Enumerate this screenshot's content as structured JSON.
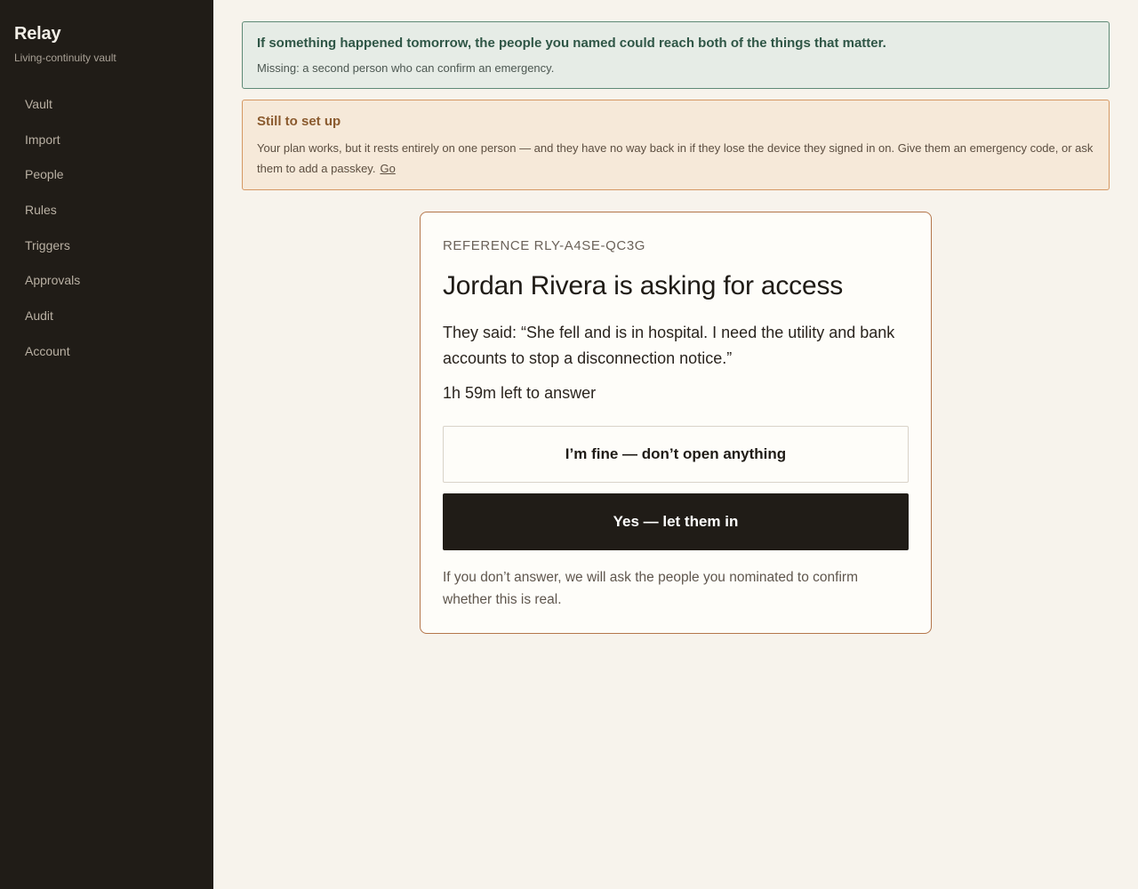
{
  "app": {
    "name": "Relay",
    "tagline": "Living-continuity vault"
  },
  "sidebar": {
    "items": [
      {
        "label": "Vault"
      },
      {
        "label": "Import"
      },
      {
        "label": "People"
      },
      {
        "label": "Rules"
      },
      {
        "label": "Triggers"
      },
      {
        "label": "Approvals"
      },
      {
        "label": "Audit"
      },
      {
        "label": "Account"
      }
    ]
  },
  "status_banner": {
    "headline": "If something happened tomorrow, the people you named could reach both of the things that matter.",
    "missing": "Missing: a second person who can confirm an emergency."
  },
  "setup_banner": {
    "title": "Still to set up",
    "body": "Your plan works, but it rests entirely on one person — and they have no way back in if they lose the device they signed in on. Give them an emergency code, or ask them to add a passkey.",
    "link": "Go"
  },
  "request": {
    "reference": "REFERENCE RLY-A4SE-QC3G",
    "heading": "Jordan Rivera is asking for access",
    "quote": "They said: “She fell and is in hospital. I need the utility and bank accounts to stop a disconnection notice.”",
    "time_left": "1h 59m left to answer",
    "deny_label": "I’m fine — don’t open anything",
    "approve_label": "Yes — let them in",
    "fallback": "If you don’t answer, we will ask the people you nominated to confirm whether this is real."
  },
  "colors": {
    "sidebar_bg": "#201c17",
    "page_bg": "#f7f3ec",
    "ok_border": "#5e8a76",
    "warn_border": "#d59863",
    "card_border": "#b4764b"
  }
}
